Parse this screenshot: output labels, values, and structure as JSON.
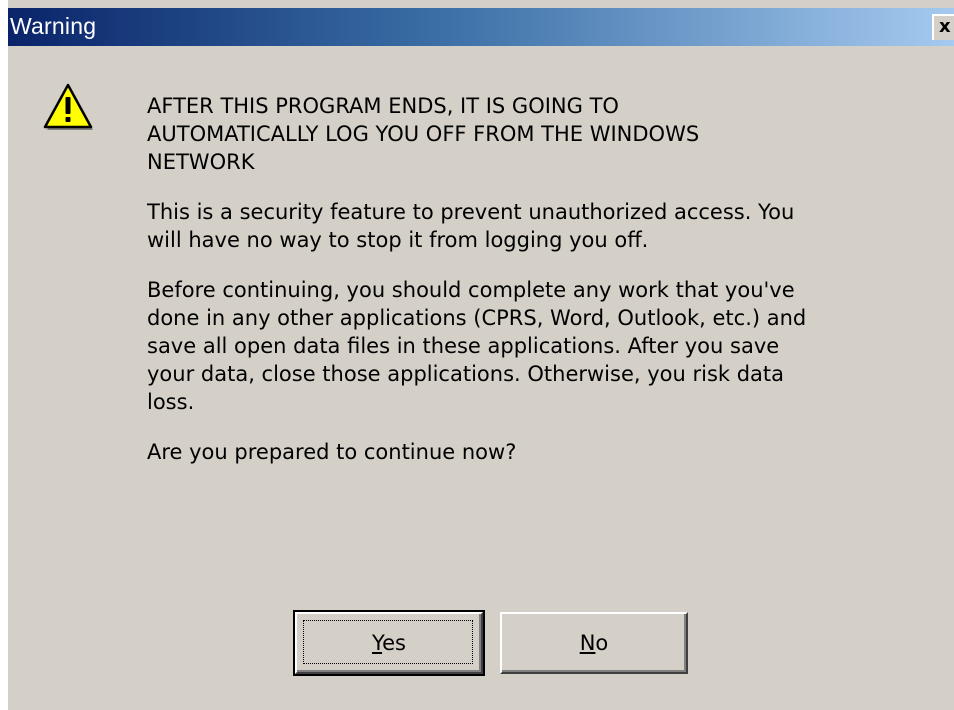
{
  "window": {
    "title": "Warning",
    "close_glyph": "x"
  },
  "icon": {
    "name": "warning-icon",
    "color": "#ffff00"
  },
  "message": {
    "heading_lines": "AFTER THIS PROGRAM ENDS, IT IS GOING TO\nAUTOMATICALLY LOG YOU OFF FROM THE WINDOWS\nNETWORK",
    "paragraph_1": "This is a security feature to prevent unauthorized access. You\nwill have no way to stop it from logging you off.",
    "paragraph_2": "Before continuing, you should complete any work that you've\ndone in any other applications (CPRS, Word, Outlook, etc.) and\nsave all open data files in these applications. After you save\nyour data, close those applications. Otherwise, you risk data\nloss.",
    "question": "Are you prepared to continue now?"
  },
  "buttons": {
    "yes": {
      "mnemonic": "Y",
      "rest": "es"
    },
    "no": {
      "mnemonic": "N",
      "rest": "o"
    }
  }
}
